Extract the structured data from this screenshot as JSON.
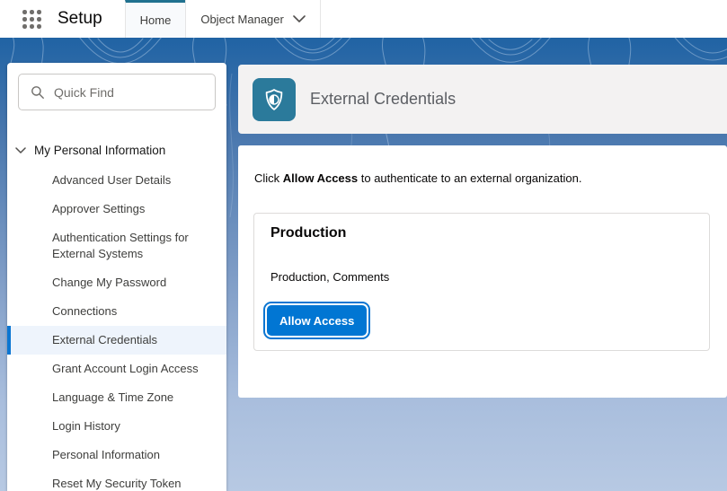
{
  "topbar": {
    "app_name": "Setup",
    "tabs": [
      {
        "label": "Home",
        "active": true
      },
      {
        "label": "Object Manager",
        "active": false
      }
    ]
  },
  "sidebar": {
    "search_placeholder": "Quick Find",
    "group_label": "My Personal Information",
    "items": [
      {
        "label": "Advanced User Details",
        "selected": false
      },
      {
        "label": "Approver Settings",
        "selected": false
      },
      {
        "label": "Authentication Settings for External Systems",
        "selected": false
      },
      {
        "label": "Change My Password",
        "selected": false
      },
      {
        "label": "Connections",
        "selected": false
      },
      {
        "label": "External Credentials",
        "selected": true
      },
      {
        "label": "Grant Account Login Access",
        "selected": false
      },
      {
        "label": "Language & Time Zone",
        "selected": false
      },
      {
        "label": "Login History",
        "selected": false
      },
      {
        "label": "Personal Information",
        "selected": false
      },
      {
        "label": "Reset My Security Token",
        "selected": false
      }
    ]
  },
  "main": {
    "page_title": "External Credentials",
    "intro": {
      "pre": "Click ",
      "bold": "Allow Access",
      "post": " to authenticate to an external organization."
    },
    "card": {
      "title": "Production",
      "subtitle": "Production, Comments",
      "button_label": "Allow Access"
    }
  },
  "icons": {
    "app_launcher": "waffle-grid-icon",
    "tab_dropdown": "chevron-down-icon",
    "group_toggle": "chevron-down-icon",
    "quick_find": "search-icon",
    "page_header": "shield-icon"
  },
  "colors": {
    "brand_blue": "#0176d3",
    "page_icon_teal": "#2b7a9b",
    "active_tab_border": "#20718f",
    "selected_nav_bg": "#eef4fc",
    "selected_nav_bar": "#0b76d2",
    "header_card_bg": "#f3f2f2",
    "canvas_gradient_top": "#2063a4",
    "canvas_gradient_bottom": "#b7c9e3"
  }
}
